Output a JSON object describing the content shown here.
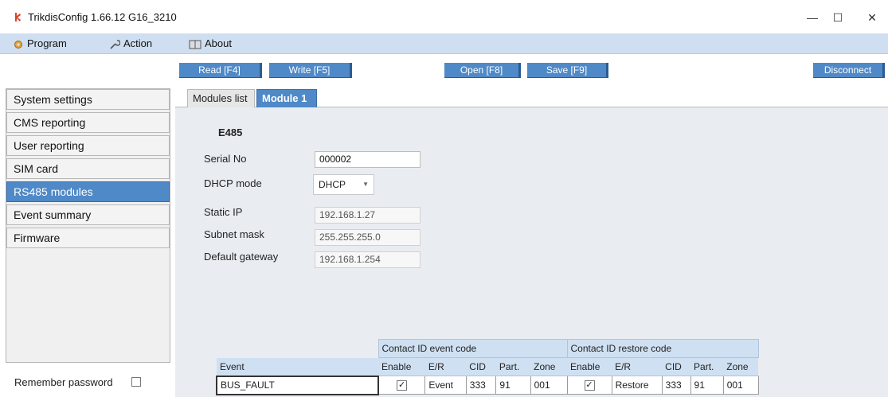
{
  "window": {
    "title": "TrikdisConfig 1.66.12  G16_3210",
    "minimize": "—",
    "maximize": "☐",
    "close": "✕"
  },
  "menu": {
    "program": "Program",
    "action": "Action",
    "about": "About"
  },
  "toolbar": {
    "read": "Read [F4]",
    "write": "Write [F5]",
    "open": "Open [F8]",
    "save": "Save [F9]",
    "disconnect": "Disconnect"
  },
  "sidebar": {
    "items": [
      {
        "label": "System settings"
      },
      {
        "label": "CMS reporting"
      },
      {
        "label": "User reporting"
      },
      {
        "label": "SIM card"
      },
      {
        "label": "RS485 modules"
      },
      {
        "label": "Event summary"
      },
      {
        "label": "Firmware"
      }
    ],
    "active_index": 4,
    "remember_password": "Remember password"
  },
  "tabs": {
    "modules_list": "Modules list",
    "module1": "Module 1"
  },
  "module": {
    "name": "E485",
    "serial_label": "Serial No",
    "serial_value": "000002",
    "dhcp_label": "DHCP mode",
    "dhcp_value": "DHCP",
    "static_ip_label": "Static IP",
    "static_ip_value": "192.168.1.27",
    "subnet_label": "Subnet mask",
    "subnet_value": "255.255.255.0",
    "gateway_label": "Default gateway",
    "gateway_value": "192.168.1.254"
  },
  "events_table": {
    "group_event": "Contact ID event code",
    "group_restore": "Contact ID restore code",
    "headers": {
      "event": "Event",
      "enable": "Enable",
      "er": "E/R",
      "cid": "CID",
      "part": "Part.",
      "zone": "Zone",
      "enable2": "Enable",
      "er2": "E/R",
      "cid2": "CID",
      "part2": "Part.",
      "zone2": "Zone"
    },
    "rows": [
      {
        "event": "BUS_FAULT",
        "enable": "✓",
        "er": "Event",
        "cid": "333",
        "part": "91",
        "zone": "001",
        "enable2": "✓",
        "er2": "Restore",
        "cid2": "333",
        "part2": "91",
        "zone2": "001"
      }
    ]
  },
  "colors": {
    "accent": "#4f89c7",
    "menubar": "#cfdff1",
    "panel": "#e9edf2"
  }
}
